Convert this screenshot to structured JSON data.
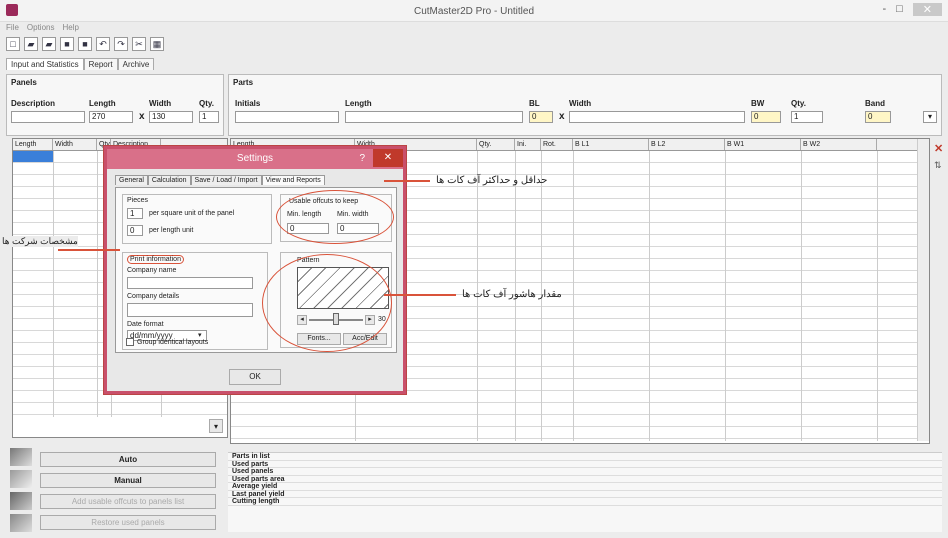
{
  "window": {
    "title": "CutMaster2D Pro - Untitled",
    "minimize": "-",
    "maximize": "□",
    "close": "✕"
  },
  "menu": [
    "File",
    "Options",
    "Help"
  ],
  "main_tabs": [
    "Input and Statistics",
    "Report",
    "Archive"
  ],
  "panels": {
    "section": "Panels",
    "labels": {
      "description": "Description",
      "length": "Length",
      "width": "Width",
      "qty": "Qty."
    },
    "values": {
      "description": "",
      "length": "270",
      "width": "130",
      "qty": "1"
    },
    "times": "x"
  },
  "parts": {
    "section": "Parts",
    "labels": {
      "initials": "Initials",
      "length": "Length",
      "bl": "BL",
      "width": "Width",
      "bw": "BW",
      "qty": "Qty.",
      "band": "Band"
    },
    "values": {
      "initials": "",
      "length": "",
      "bl": "0",
      "width": "",
      "bw": "0",
      "qty": "1",
      "band": "0"
    },
    "times": "x"
  },
  "panel_columns": [
    "Length",
    "Width",
    "Qty.",
    "Description"
  ],
  "part_columns": [
    "Length",
    "Width",
    "Qty.",
    "Ini.",
    "Rot.",
    "B L1",
    "B L2",
    "B W1",
    "B W2"
  ],
  "buttons": {
    "auto": "Auto",
    "manual": "Manual",
    "add_offcuts": "Add usable offcuts to panels list",
    "restore": "Restore used panels"
  },
  "stats": [
    "Parts in list",
    "Used parts",
    "Used panels",
    "Used parts area",
    "Average yield",
    "Last panel yield",
    "Cutting length"
  ],
  "dialog": {
    "title": "Settings",
    "help": "?",
    "close": "✕",
    "tabs": [
      "General",
      "Calculation",
      "Save / Load / Import",
      "View and Reports"
    ],
    "pieces": {
      "label": "Pieces",
      "rows": [
        {
          "value": "1",
          "text": "per square unit of the panel"
        },
        {
          "value": "0",
          "text": "per length unit"
        }
      ]
    },
    "offcuts": {
      "label": "Usable offcuts to keep",
      "min_length_label": "Min. length",
      "min_width_label": "Min. width",
      "min_length": "0",
      "min_width": "0"
    },
    "print": {
      "label": "Print information",
      "company_name_label": "Company name",
      "company_name": "",
      "company_details_label": "Company details",
      "company_details": "",
      "date_format_label": "Date format",
      "date_format": "dd/mm/yyyy",
      "group_label": "Group identical layouts"
    },
    "pattern": {
      "label": "Pattern",
      "value": "30",
      "fonts_button": "Fonts...",
      "accept_button": "Acc/Edit"
    },
    "ok": "OK"
  },
  "annotations": {
    "offcuts": "حداقل و حداکثر آف کات ها",
    "company": "مشخصات شرکت ها",
    "pattern": "مقدار هاشور آف کات ها"
  },
  "icons": [
    "new-icon",
    "open-icon",
    "save-icon",
    "save-as-icon",
    "undo-icon",
    "redo-icon",
    "cut-icon",
    "settings-icon"
  ]
}
